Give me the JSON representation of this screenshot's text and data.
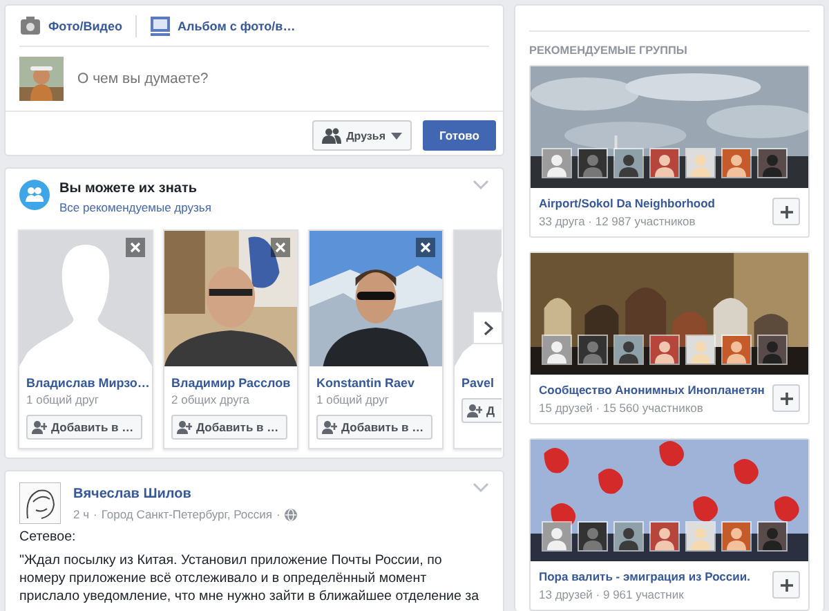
{
  "composer": {
    "tabs": [
      {
        "label": "Фото/Видео"
      },
      {
        "label": "Альбом с фото/в…",
        "kind": "album"
      }
    ],
    "placeholder": "О чем вы думаете?",
    "audience": "Друзья",
    "submit": "Готово"
  },
  "people_you_may_know": {
    "title": "Вы можете их знать",
    "link": "Все рекомендуемые друзья",
    "people": [
      {
        "name": "Владислав Мирзо…",
        "mutual": "1 общий друг",
        "add": "Добавить в …",
        "kind": "silhouette",
        "closable": true
      },
      {
        "name": "Владимир Расслов",
        "mutual": "2 общих друга",
        "add": "Добавить в …",
        "kind": "indoor",
        "closable": true
      },
      {
        "name": "Konstantin Raev",
        "mutual": "1 общий друг",
        "add": "Добавить в …",
        "kind": "mountain",
        "closable": true
      },
      {
        "name": "Pavel",
        "add": "Д",
        "kind": "silhouette",
        "closable": false
      }
    ]
  },
  "post": {
    "author": "Вячеслав Шилов",
    "time": "2 ч",
    "location": "Город Санкт-Петербург, Россия",
    "separator": "·",
    "paragraphs": [
      "Сетевое:",
      "\"Ждал посылку из Китая. Установил приложение Почты России, по номеру приложение всё отслеживало и в определённый момент прислало уведомление, что мне нужно зайти в ближайшее отделение за"
    ]
  },
  "recommended_groups": {
    "heading": "РЕКОМЕНДУЕМЫЕ ГРУППЫ",
    "groups": [
      {
        "name": "Airport/Sokol Da Neighborhood",
        "stats": "33 друга · 12 987 участников",
        "kind": "sky"
      },
      {
        "name": "Сообщество Анонимных Инопланетян",
        "stats": "15 друзей · 15 560 участников",
        "kind": "crowd"
      },
      {
        "name": "Пора валить - эмиграция из России.",
        "stats": "13 друзей · 9 961 участник",
        "kind": "pattern"
      }
    ]
  }
}
